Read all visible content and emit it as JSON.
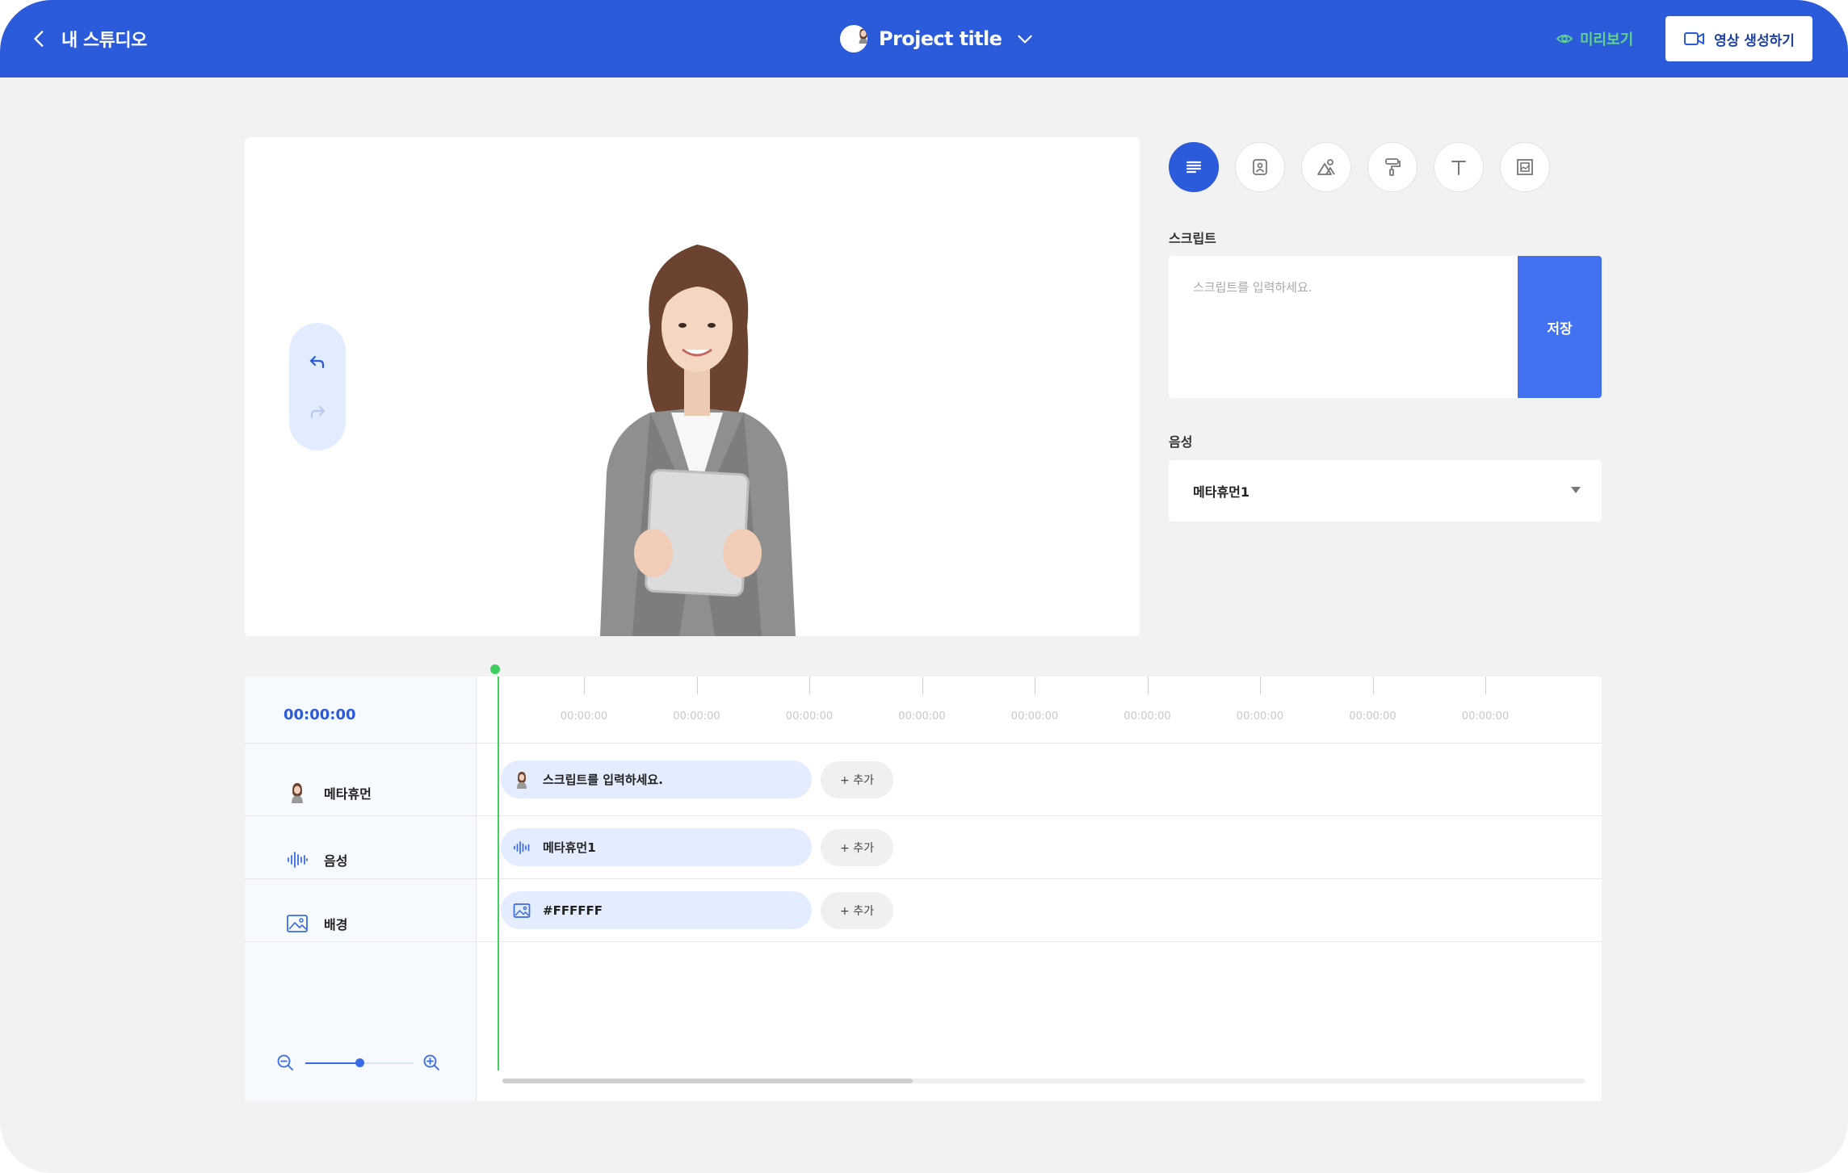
{
  "header": {
    "back_label": "내 스튜디오",
    "project_title": "Project title",
    "preview_label": "미리보기",
    "create_label": "영상 생성하기"
  },
  "colors": {
    "primary": "#2b5bdb",
    "save_button": "#4272f2",
    "preview_text": "#5fd38a",
    "playhead": "#3fcf5f",
    "clip_bg": "#e3edff"
  },
  "tools": [
    {
      "icon": "script-lines-icon",
      "active": true
    },
    {
      "icon": "avatar-frame-icon",
      "active": false
    },
    {
      "icon": "shapes-icon",
      "active": false
    },
    {
      "icon": "paint-roller-icon",
      "active": false
    },
    {
      "icon": "text-t-icon",
      "active": false
    },
    {
      "icon": "image-frame-icon",
      "active": false
    }
  ],
  "panel": {
    "script_label": "스크립트",
    "script_placeholder": "스크립트를 입력하세요.",
    "save_label": "저장",
    "voice_label": "음성",
    "voice_value": "메타휴먼1"
  },
  "timeline": {
    "current_time": "00:00:00",
    "ticks": [
      "00:00:00",
      "00:00:00",
      "00:00:00",
      "00:00:00",
      "00:00:00",
      "00:00:00",
      "00:00:00",
      "00:00:00",
      "00:00:00"
    ],
    "tracks": [
      {
        "label": "메타휴먼",
        "icon": "avatar-icon",
        "clip": "스크립트를 입력하세요.",
        "clip_icon": "avatar-icon",
        "add": "+ 추가"
      },
      {
        "label": "음성",
        "icon": "waveform-icon",
        "clip": "메타휴먼1",
        "clip_icon": "waveform-icon",
        "add": "+ 추가"
      },
      {
        "label": "배경",
        "icon": "image-icon",
        "clip": "#FFFFFF",
        "clip_icon": "image-icon",
        "add": "+ 추가"
      }
    ],
    "zoom_level": 0.5,
    "scroll_fraction": 0.38
  }
}
